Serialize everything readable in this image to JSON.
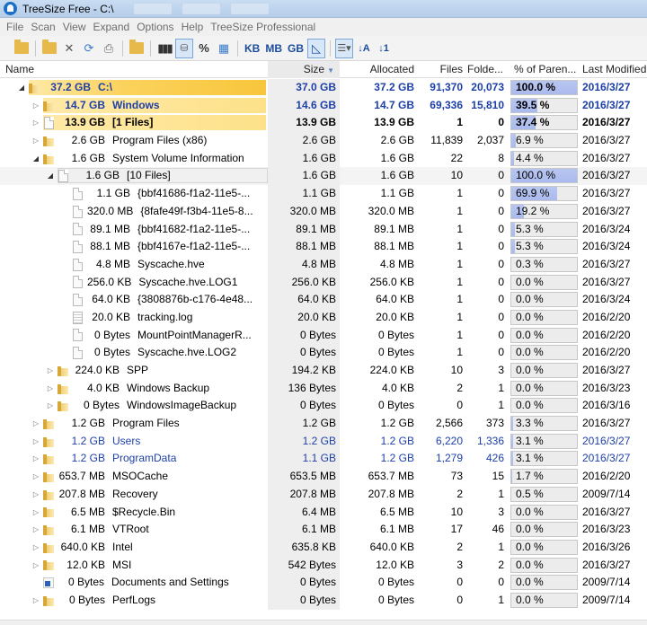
{
  "window": {
    "title": "TreeSize Free - C:\\"
  },
  "menu": [
    "File",
    "Scan",
    "View",
    "Expand",
    "Options",
    "Help",
    "TreeSize Professional"
  ],
  "toolbar": {
    "kb": "KB",
    "mb": "MB",
    "gb": "GB",
    "percent": "%",
    "sort_az": "↓A",
    "sort_19": "↓1"
  },
  "columns": [
    "Name",
    "Size",
    "Allocated",
    "Files",
    "Folde...",
    "% of Paren...",
    "Last Modified"
  ],
  "colors": {
    "yellow_bar": "#fbd25c",
    "selected_bar": "#ffe9a6",
    "percent_fill": "#aebcee",
    "link_blue": "#1d3fa8"
  },
  "rows": [
    {
      "level": 0,
      "exp": "open",
      "icon": "folder",
      "nsize": "37.2 GB",
      "name": "C:\\",
      "size": "37.0 GB",
      "alloc": "37.2 GB",
      "files": "91,370",
      "folders": "20,073",
      "pct": "100.0 %",
      "pv": 100,
      "mod": "2016/3/27",
      "bar": 1.0,
      "bold": true,
      "blue": true
    },
    {
      "level": 1,
      "exp": "closed",
      "icon": "folder",
      "nsize": "14.7 GB",
      "name": "Windows",
      "size": "14.6 GB",
      "alloc": "14.7 GB",
      "files": "69,336",
      "folders": "15,810",
      "pct": "39.5 %",
      "pv": 39.5,
      "mod": "2016/3/27",
      "bar": 1.0,
      "bold": true,
      "blue": true
    },
    {
      "level": 1,
      "exp": "closed",
      "icon": "file",
      "nsize": "13.9 GB",
      "name": "[1 Files]",
      "size": "13.9 GB",
      "alloc": "13.9 GB",
      "files": "1",
      "folders": "0",
      "pct": "37.4 %",
      "pv": 37.4,
      "mod": "2016/3/27",
      "bar": 1.0,
      "bold": true,
      "blue": false
    },
    {
      "level": 1,
      "exp": "closed",
      "icon": "folder",
      "nsize": "2.6 GB",
      "name": "Program Files (x86)",
      "size": "2.6 GB",
      "alloc": "2.6 GB",
      "files": "11,839",
      "folders": "2,037",
      "pct": "6.9 %",
      "pv": 6.9,
      "mod": "2016/3/27",
      "bar": 0,
      "bold": false,
      "blue": false
    },
    {
      "level": 1,
      "exp": "open",
      "icon": "folder",
      "nsize": "1.6 GB",
      "name": "System Volume Information",
      "size": "1.6 GB",
      "alloc": "1.6 GB",
      "files": "22",
      "folders": "8",
      "pct": "4.4 %",
      "pv": 4.4,
      "mod": "2016/3/27",
      "bar": 0,
      "bold": false,
      "blue": false
    },
    {
      "level": 2,
      "exp": "open",
      "icon": "file",
      "nsize": "1.6 GB",
      "name": "[10 Files]",
      "size": "1.6 GB",
      "alloc": "1.6 GB",
      "files": "10",
      "folders": "0",
      "pct": "100.0 %",
      "pv": 100,
      "mod": "2016/3/27",
      "bar": 0,
      "bold": false,
      "blue": false,
      "selected": true
    },
    {
      "level": 3,
      "exp": "",
      "icon": "file",
      "nsize": "1.1 GB",
      "name": "{bbf41686-f1a2-11e5-...",
      "size": "1.1 GB",
      "alloc": "1.1 GB",
      "files": "1",
      "folders": "0",
      "pct": "69.9 %",
      "pv": 69.9,
      "mod": "2016/3/27",
      "bar": 0,
      "bold": false,
      "blue": false
    },
    {
      "level": 3,
      "exp": "",
      "icon": "file",
      "nsize": "320.0 MB",
      "name": "{8fafe49f-f3b4-11e5-8...",
      "size": "320.0 MB",
      "alloc": "320.0 MB",
      "files": "1",
      "folders": "0",
      "pct": "19.2 %",
      "pv": 19.2,
      "mod": "2016/3/27",
      "bar": 0,
      "bold": false,
      "blue": false
    },
    {
      "level": 3,
      "exp": "",
      "icon": "file",
      "nsize": "89.1 MB",
      "name": "{bbf41682-f1a2-11e5-...",
      "size": "89.1 MB",
      "alloc": "89.1 MB",
      "files": "1",
      "folders": "0",
      "pct": "5.3 %",
      "pv": 5.3,
      "mod": "2016/3/24",
      "bar": 0,
      "bold": false,
      "blue": false
    },
    {
      "level": 3,
      "exp": "",
      "icon": "file",
      "nsize": "88.1 MB",
      "name": "{bbf4167e-f1a2-11e5-...",
      "size": "88.1 MB",
      "alloc": "88.1 MB",
      "files": "1",
      "folders": "0",
      "pct": "5.3 %",
      "pv": 5.3,
      "mod": "2016/3/24",
      "bar": 0,
      "bold": false,
      "blue": false
    },
    {
      "level": 3,
      "exp": "",
      "icon": "file",
      "nsize": "4.8 MB",
      "name": "Syscache.hve",
      "size": "4.8 MB",
      "alloc": "4.8 MB",
      "files": "1",
      "folders": "0",
      "pct": "0.3 %",
      "pv": 0.3,
      "mod": "2016/3/27",
      "bar": 0,
      "bold": false,
      "blue": false
    },
    {
      "level": 3,
      "exp": "",
      "icon": "file",
      "nsize": "256.0 KB",
      "name": "Syscache.hve.LOG1",
      "size": "256.0 KB",
      "alloc": "256.0 KB",
      "files": "1",
      "folders": "0",
      "pct": "0.0 %",
      "pv": 0,
      "mod": "2016/3/27",
      "bar": 0,
      "bold": false,
      "blue": false
    },
    {
      "level": 3,
      "exp": "",
      "icon": "file",
      "nsize": "64.0 KB",
      "name": "{3808876b-c176-4e48...",
      "size": "64.0 KB",
      "alloc": "64.0 KB",
      "files": "1",
      "folders": "0",
      "pct": "0.0 %",
      "pv": 0,
      "mod": "2016/3/24",
      "bar": 0,
      "bold": false,
      "blue": false
    },
    {
      "level": 3,
      "exp": "",
      "icon": "logfile",
      "nsize": "20.0 KB",
      "name": "tracking.log",
      "size": "20.0 KB",
      "alloc": "20.0 KB",
      "files": "1",
      "folders": "0",
      "pct": "0.0 %",
      "pv": 0,
      "mod": "2016/2/20",
      "bar": 0,
      "bold": false,
      "blue": false
    },
    {
      "level": 3,
      "exp": "",
      "icon": "file",
      "nsize": "0 Bytes",
      "name": "MountPointManagerR...",
      "size": "0 Bytes",
      "alloc": "0 Bytes",
      "files": "1",
      "folders": "0",
      "pct": "0.0 %",
      "pv": 0,
      "mod": "2016/2/20",
      "bar": 0,
      "bold": false,
      "blue": false
    },
    {
      "level": 3,
      "exp": "",
      "icon": "file",
      "nsize": "0 Bytes",
      "name": "Syscache.hve.LOG2",
      "size": "0 Bytes",
      "alloc": "0 Bytes",
      "files": "1",
      "folders": "0",
      "pct": "0.0 %",
      "pv": 0,
      "mod": "2016/2/20",
      "bar": 0,
      "bold": false,
      "blue": false
    },
    {
      "level": 2,
      "exp": "closed",
      "icon": "folder",
      "nsize": "224.0 KB",
      "name": "SPP",
      "size": "194.2 KB",
      "alloc": "224.0 KB",
      "files": "10",
      "folders": "3",
      "pct": "0.0 %",
      "pv": 0,
      "mod": "2016/3/27",
      "bar": 0,
      "bold": false,
      "blue": false
    },
    {
      "level": 2,
      "exp": "closed",
      "icon": "folder",
      "nsize": "4.0 KB",
      "name": "Windows Backup",
      "size": "136 Bytes",
      "alloc": "4.0 KB",
      "files": "2",
      "folders": "1",
      "pct": "0.0 %",
      "pv": 0,
      "mod": "2016/3/23",
      "bar": 0,
      "bold": false,
      "blue": false
    },
    {
      "level": 2,
      "exp": "closed",
      "icon": "folder",
      "nsize": "0 Bytes",
      "name": "WindowsImageBackup",
      "size": "0 Bytes",
      "alloc": "0 Bytes",
      "files": "0",
      "folders": "1",
      "pct": "0.0 %",
      "pv": 0,
      "mod": "2016/3/16",
      "bar": 0,
      "bold": false,
      "blue": false
    },
    {
      "level": 1,
      "exp": "closed",
      "icon": "folder",
      "nsize": "1.2 GB",
      "name": "Program Files",
      "size": "1.2 GB",
      "alloc": "1.2 GB",
      "files": "2,566",
      "folders": "373",
      "pct": "3.3 %",
      "pv": 3.3,
      "mod": "2016/3/27",
      "bar": 0,
      "bold": false,
      "blue": false
    },
    {
      "level": 1,
      "exp": "closed",
      "icon": "folder",
      "nsize": "1.2 GB",
      "name": "Users",
      "size": "1.2 GB",
      "alloc": "1.2 GB",
      "files": "6,220",
      "folders": "1,336",
      "pct": "3.1 %",
      "pv": 3.1,
      "mod": "2016/3/27",
      "bar": 0,
      "bold": false,
      "blue": true
    },
    {
      "level": 1,
      "exp": "closed",
      "icon": "folder",
      "nsize": "1.2 GB",
      "name": "ProgramData",
      "size": "1.1 GB",
      "alloc": "1.2 GB",
      "files": "1,279",
      "folders": "426",
      "pct": "3.1 %",
      "pv": 3.1,
      "mod": "2016/3/27",
      "bar": 0,
      "bold": false,
      "blue": true
    },
    {
      "level": 1,
      "exp": "closed",
      "icon": "folder",
      "nsize": "653.7 MB",
      "name": "MSOCache",
      "size": "653.5 MB",
      "alloc": "653.7 MB",
      "files": "73",
      "folders": "15",
      "pct": "1.7 %",
      "pv": 1.7,
      "mod": "2016/2/20",
      "bar": 0,
      "bold": false,
      "blue": false
    },
    {
      "level": 1,
      "exp": "closed",
      "icon": "folder",
      "nsize": "207.8 MB",
      "name": "Recovery",
      "size": "207.8 MB",
      "alloc": "207.8 MB",
      "files": "2",
      "folders": "1",
      "pct": "0.5 %",
      "pv": 0.5,
      "mod": "2009/7/14",
      "bar": 0,
      "bold": false,
      "blue": false
    },
    {
      "level": 1,
      "exp": "closed",
      "icon": "folder",
      "nsize": "6.5 MB",
      "name": "$Recycle.Bin",
      "size": "6.4 MB",
      "alloc": "6.5 MB",
      "files": "10",
      "folders": "3",
      "pct": "0.0 %",
      "pv": 0,
      "mod": "2016/3/27",
      "bar": 0,
      "bold": false,
      "blue": false
    },
    {
      "level": 1,
      "exp": "closed",
      "icon": "folder",
      "nsize": "6.1 MB",
      "name": "VTRoot",
      "size": "6.1 MB",
      "alloc": "6.1 MB",
      "files": "17",
      "folders": "46",
      "pct": "0.0 %",
      "pv": 0,
      "mod": "2016/3/23",
      "bar": 0,
      "bold": false,
      "blue": false
    },
    {
      "level": 1,
      "exp": "closed",
      "icon": "folder",
      "nsize": "640.0 KB",
      "name": "Intel",
      "size": "635.8 KB",
      "alloc": "640.0 KB",
      "files": "2",
      "folders": "1",
      "pct": "0.0 %",
      "pv": 0,
      "mod": "2016/3/26",
      "bar": 0,
      "bold": false,
      "blue": false
    },
    {
      "level": 1,
      "exp": "closed",
      "icon": "folder",
      "nsize": "12.0 KB",
      "name": "MSI",
      "size": "542 Bytes",
      "alloc": "12.0 KB",
      "files": "3",
      "folders": "2",
      "pct": "0.0 %",
      "pv": 0,
      "mod": "2016/3/27",
      "bar": 0,
      "bold": false,
      "blue": false
    },
    {
      "level": 1,
      "exp": "",
      "icon": "shortcut",
      "nsize": "0 Bytes",
      "name": "Documents and Settings",
      "size": "0 Bytes",
      "alloc": "0 Bytes",
      "files": "0",
      "folders": "0",
      "pct": "0.0 %",
      "pv": 0,
      "mod": "2009/7/14",
      "bar": 0,
      "bold": false,
      "blue": false
    },
    {
      "level": 1,
      "exp": "closed",
      "icon": "folder",
      "nsize": "0 Bytes",
      "name": "PerfLogs",
      "size": "0 Bytes",
      "alloc": "0 Bytes",
      "files": "0",
      "folders": "1",
      "pct": "0.0 %",
      "pv": 0,
      "mod": "2009/7/14",
      "bar": 0,
      "bold": false,
      "blue": false
    }
  ]
}
